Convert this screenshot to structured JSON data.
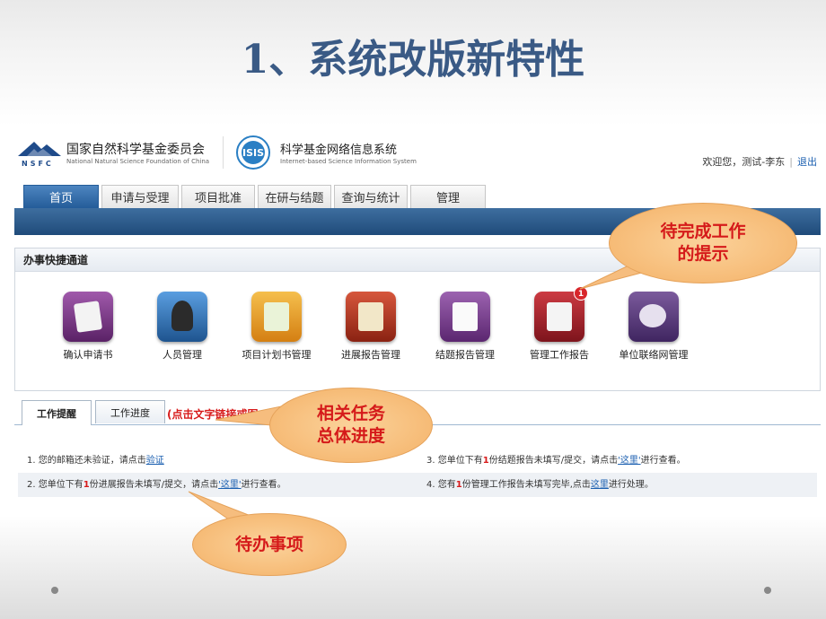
{
  "slide_title": "1、系统改版新特性",
  "header": {
    "org_cn": "国家自然科学基金委员会",
    "org_en": "National Natural Science Foundation of China",
    "org_abbr": "NSFC",
    "sys_logo_text": "ISIS",
    "sys_cn": "科学基金网络信息系统",
    "sys_en": "Internet-based Science Information System",
    "welcome": "欢迎您，测试-李东",
    "logout": "退出"
  },
  "tabs": [
    "首页",
    "申请与受理",
    "项目批准",
    "在研与结题",
    "查询与统计",
    "管理"
  ],
  "quick": {
    "title": "办事快捷通道",
    "items": [
      {
        "label": "确认申请书",
        "icon": "application-confirm-icon",
        "color": "#7d3a86"
      },
      {
        "label": "人员管理",
        "icon": "personnel-icon",
        "color": "#2e6fb5"
      },
      {
        "label": "项目计划书管理",
        "icon": "plan-document-icon",
        "color": "#e59a24"
      },
      {
        "label": "进展报告管理",
        "icon": "progress-report-icon",
        "color": "#b2331d"
      },
      {
        "label": "结题报告管理",
        "icon": "final-report-icon",
        "color": "#7a3f8e"
      },
      {
        "label": "管理工作报告",
        "icon": "work-report-icon",
        "color": "#a8232c",
        "badge": "1"
      },
      {
        "label": "单位联络网管理",
        "icon": "network-icon",
        "color": "#5c3d7c"
      }
    ]
  },
  "work": {
    "tab_reminder": "工作提醒",
    "tab_progress": "工作进度",
    "link_hint": "(点击文字链接或图"
  },
  "notes": {
    "n1_pre": "1. 您的邮箱还未验证，请点击",
    "n1_link": "验证",
    "n2_pre": "2. 您单位下有",
    "n2_count": "1",
    "n2_mid": "份进展报告未填写/提交，请点击",
    "n2_link": "'这里'",
    "n2_post": "进行查看。",
    "n3_pre": "3. 您单位下有",
    "n3_count": "1",
    "n3_mid": "份结题报告未填写/提交，请点击",
    "n3_link": "'这里'",
    "n3_post": "进行查看。",
    "n4_pre": "4. 您有",
    "n4_count": "1",
    "n4_mid": "份管理工作报告未填写完毕,点击",
    "n4_link": "这里",
    "n4_post": "进行处理。"
  },
  "callouts": {
    "pending_line1": "待完成工作",
    "pending_line2": "的提示",
    "progress_line1": "相关任务",
    "progress_line2": "总体进度",
    "todo": "待办事项"
  }
}
